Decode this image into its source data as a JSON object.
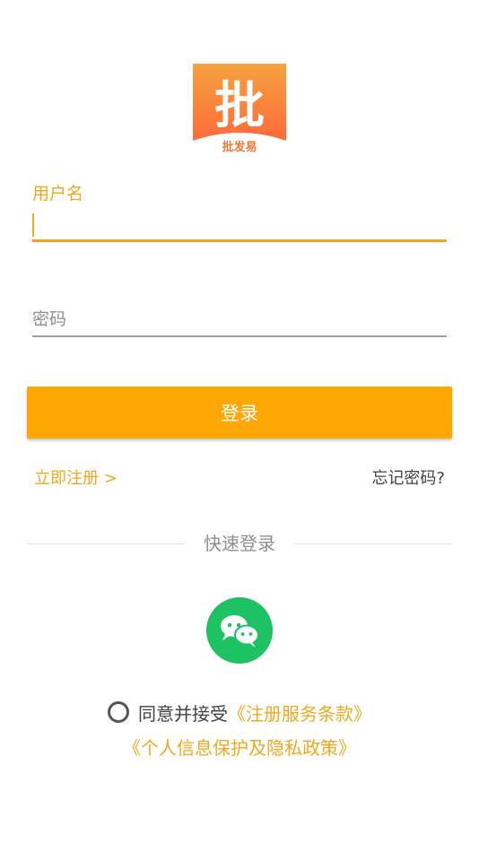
{
  "app": {
    "logo_glyph": "批",
    "logo_name": "批发易"
  },
  "login_form": {
    "username_label": "用户名",
    "username_value": "",
    "password_placeholder": "密码",
    "password_value": "",
    "login_button_label": "登录"
  },
  "links": {
    "register": "立即注册 >",
    "forgot_password": "忘记密码?"
  },
  "quick_login": {
    "title": "快速登录",
    "wechat_icon": "wechat-icon"
  },
  "agreement": {
    "checked": false,
    "prefix": "同意并接受",
    "terms_link": "《注册服务条款》",
    "privacy_link": "《个人信息保护及隐私政策》"
  },
  "colors": {
    "accent": "#f2a81d",
    "button": "#ffa705",
    "wechat": "#1dc263"
  }
}
